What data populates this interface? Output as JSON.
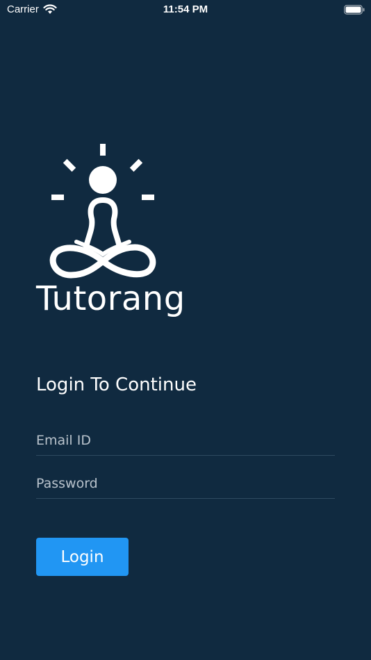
{
  "status_bar": {
    "carrier": "Carrier",
    "time": "11:54 PM",
    "wifi_icon": "wifi-icon",
    "battery_icon": "battery-icon"
  },
  "brand": {
    "logo_icon": "meditation-logo-icon",
    "name": "Tutorang"
  },
  "login": {
    "heading": "Login To Continue",
    "email_placeholder": "Email ID",
    "email_value": "",
    "password_placeholder": "Password",
    "password_value": "",
    "button_label": "Login"
  },
  "colors": {
    "background": "#102a40",
    "accent": "#2196f3",
    "text": "#ffffff",
    "placeholder": "#b9c3cc",
    "divider": "#2f4a60"
  }
}
